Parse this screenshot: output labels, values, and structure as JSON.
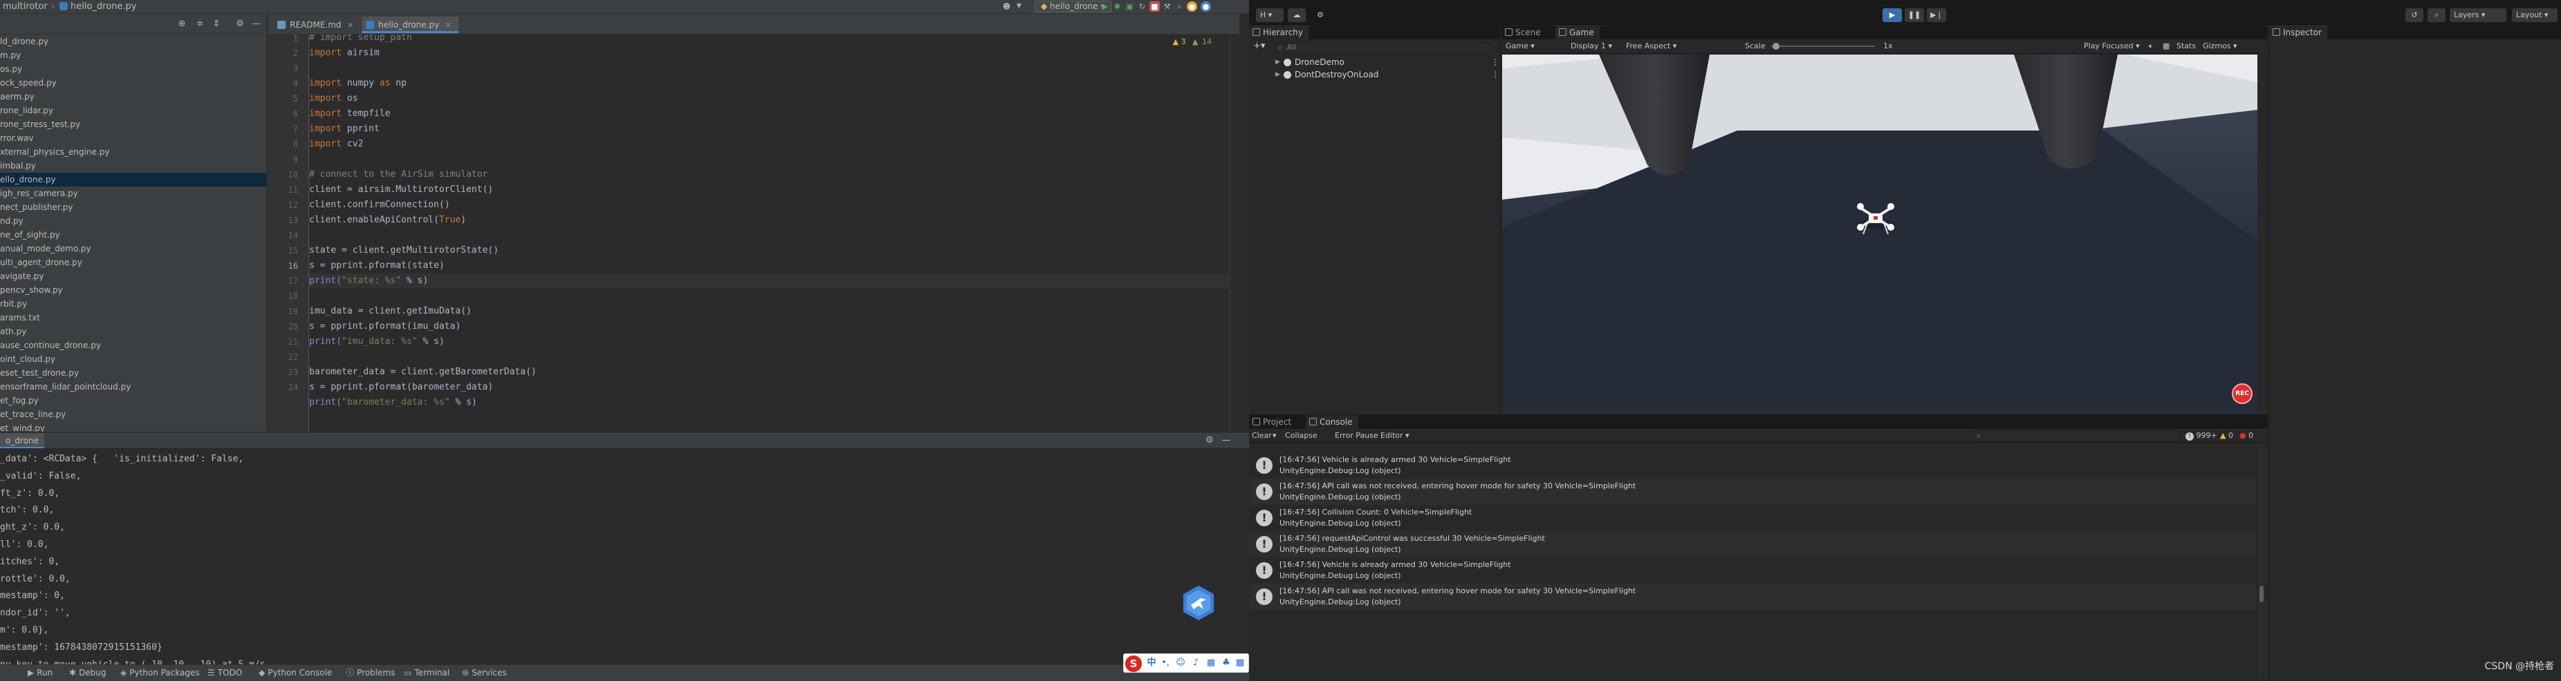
{
  "pycharm": {
    "titlebar": {
      "crumb_root": "multirotor",
      "crumb_file": "hello_drone.py",
      "run_config": "hello_drone"
    },
    "project_files": [
      "ld_drone.py",
      "m.py",
      "os.py",
      "ock_speed.py",
      "aerm.py",
      "rone_lidar.py",
      "rone_stress_test.py",
      "rror.wav",
      "xternal_physics_engine.py",
      "imbal.py",
      "ello_drone.py",
      "igh_res_camera.py",
      "nect_publisher.py",
      "nd.py",
      "ne_of_sight.py",
      "anual_mode_demo.py",
      "ulti_agent_drone.py",
      "avigate.py",
      "pencv_show.py",
      "rbit.py",
      "arams.txt",
      "ath.py",
      "ause_continue_drone.py",
      "oint_cloud.py",
      "eset_test_drone.py",
      "ensorframe_lidar_pointcloud.py",
      "et_fog.py",
      "et_trace_line.py",
      "et_wind.py"
    ],
    "selected_index": 10,
    "tabs": [
      {
        "label": "README.md",
        "type": "md"
      },
      {
        "label": "hello_drone.py",
        "type": "py",
        "active": true
      }
    ],
    "inspections": {
      "warnings": "3",
      "weak": "14"
    },
    "code": {
      "comment_top": "# import setup_path",
      "import_airsim": "airsim",
      "import_numpy": "numpy",
      "as_np": "np",
      "import_os": "os",
      "import_tempfile": "tempfile",
      "import_pprint": "pprint",
      "import_cv2": "cv2",
      "comment_connect": "# connect to the AirSim simulator",
      "l10": "client = airsim.MultirotorClient()",
      "l11": "client.confirmConnection()",
      "l12_a": "client.enableApiControl(",
      "l12_b": "True",
      "l12_c": ")",
      "l14": "state = client.getMultirotorState()",
      "l15": "s = pprint.pformat(state)",
      "l16_str": "\"state: %s\"",
      "l16_rest": " % s)",
      "l18": "imu_data = client.getImuData()",
      "l19": "s = pprint.pformat(imu_data)",
      "l20_str": "\"imu_data: %s\"",
      "l20_rest": " % s)",
      "l22": "barometer_data = client.getBarometerData()",
      "l23": "s = pprint.pformat(barometer_data)",
      "l24_str": "\"barometer_data: %s\"",
      "l24_rest": " % s)",
      "kw_import": "import",
      "kw_as": "as",
      "fn_print": "print("
    },
    "line_numbers": [
      "1",
      "2",
      "3",
      "4",
      "5",
      "6",
      "7",
      "8",
      "9",
      "10",
      "11",
      "12",
      "13",
      "14",
      "15",
      "16",
      "17",
      "18",
      "19",
      "20",
      "21",
      "22",
      "23",
      "24"
    ],
    "run_tab": "o_drone",
    "run_output": [
      "_data': <RCData> {   'is_initialized': False,",
      "_valid': False,",
      "ft_z': 0.0,",
      "tch': 0.0,",
      "ght_z': 0.0,",
      "ll': 0.0,",
      "itches': 0,",
      "rottle': 0.0,",
      "mestamp': 0,",
      "ndor_id': '',",
      "m': 0.0},",
      "mestamp': 1678438072915151360}",
      "ny key to move vehicle to (-10, 10, -10) at 5 m/s"
    ],
    "tool_windows": [
      "Run",
      "Debug",
      "Python Packages",
      "TODO",
      "Python Console",
      "Problems",
      "Terminal",
      "Services"
    ]
  },
  "unity": {
    "toolbar": {
      "account": "H",
      "layers": "Layers",
      "layout": "Layout"
    },
    "hierarchy": {
      "tab": "Hierarchy",
      "search_placeholder": "All",
      "rows": [
        "DroneDemo",
        "DontDestroyOnLoad"
      ]
    },
    "scene_tab": "Scene",
    "game_tab": "Game",
    "game_toolbar": {
      "display_mode": "Game",
      "display": "Display 1",
      "aspect": "Free Aspect",
      "scale_label": "Scale",
      "scale_value": "1x",
      "play_mode": "Play Focused",
      "stats": "Stats",
      "gizmos": "Gizmos"
    },
    "game_rec": "REC",
    "inspector_tab": "Inspector",
    "project_tab": "Project",
    "console_tab": "Console",
    "console_toolbar": {
      "clear": "Clear",
      "collapse": "Collapse",
      "error_pause": "Error Pause",
      "editor": "Editor",
      "count_logs": "999+",
      "count_warn": "0",
      "count_err": "0"
    },
    "console_entries": [
      {
        "msg": "[16:47:56] Vehicle is already armed 30 Vehicle=SimpleFlight",
        "src": "UnityEngine.Debug:Log (object)"
      },
      {
        "msg": "[16:47:56] API call was not received, entering hover mode for safety 30 Vehicle=SimpleFlight",
        "src": "UnityEngine.Debug:Log (object)"
      },
      {
        "msg": "[16:47:56] Collision Count: 0 Vehicle=SimpleFlight",
        "src": "UnityEngine.Debug:Log (object)"
      },
      {
        "msg": "[16:47:56] requestApiControl was successful 30 Vehicle=SimpleFlight",
        "src": "UnityEngine.Debug:Log (object)"
      },
      {
        "msg": "[16:47:56] Vehicle is already armed 30 Vehicle=SimpleFlight",
        "src": "UnityEngine.Debug:Log (object)"
      },
      {
        "msg": "[16:47:56] API call was not received, entering hover mode for safety 30 Vehicle=SimpleFlight",
        "src": "UnityEngine.Debug:Log (object)"
      }
    ]
  },
  "watermark": "CSDN @持枪者",
  "colors": {
    "pycharm_bg": "#2b2b2b",
    "unity_bg": "#282828",
    "accent": "#4a88c7",
    "play": "#3a6ea8"
  }
}
